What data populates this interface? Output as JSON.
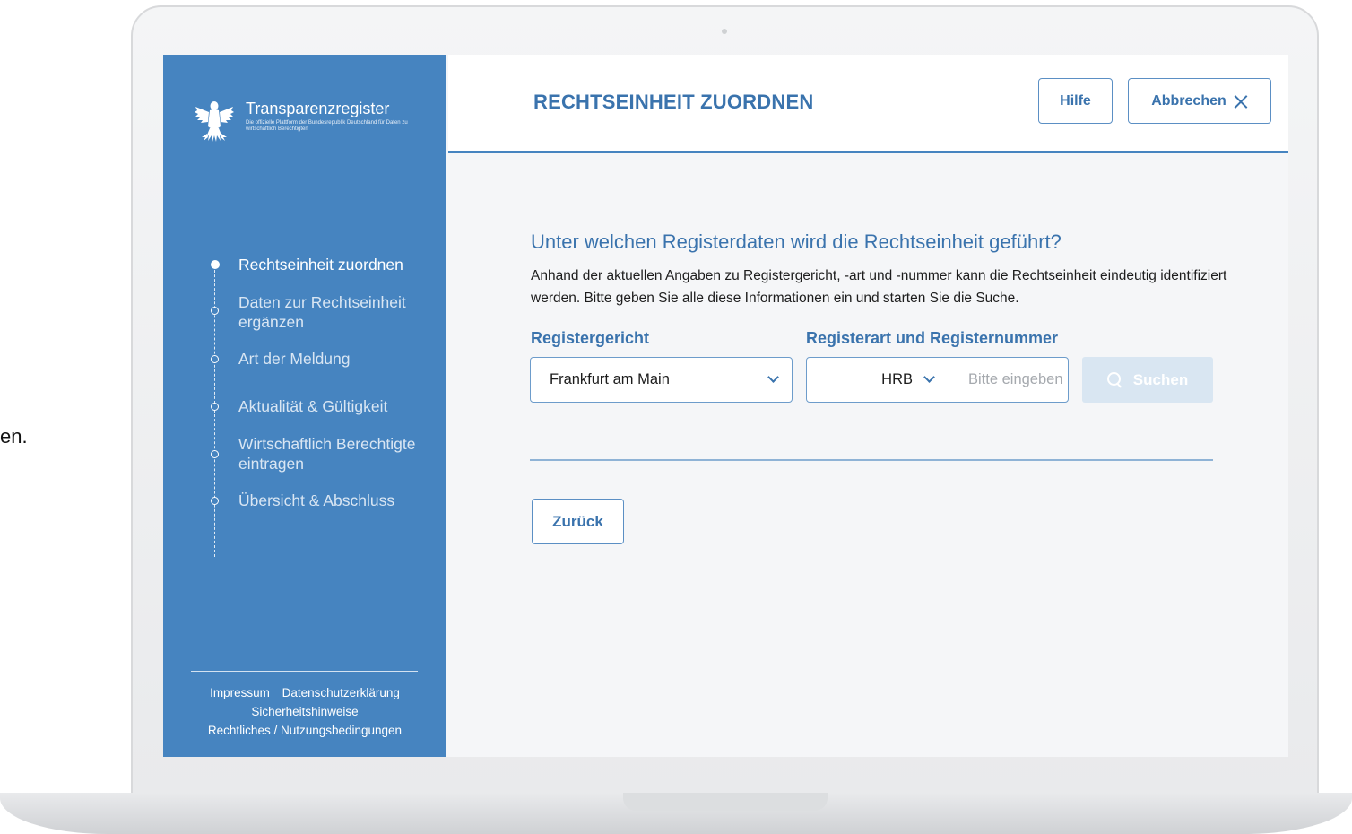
{
  "outside": {
    "fragment": "en."
  },
  "sidebar": {
    "brand_title": "Transparenzregister",
    "brand_subtitle": "Die offizielle Plattform der Bundesrepublik Deutschland für Daten zu wirtschaftlich Berechtigten",
    "logo_icon": "federal-eagle-icon",
    "steps": [
      {
        "label": "Rechtseinheit zuordnen",
        "active": true
      },
      {
        "label": "Daten zur Rechtseinheit ergänzen",
        "active": false
      },
      {
        "label": "Art der Meldung",
        "active": false
      },
      {
        "label": "Aktualität & Gültigkeit",
        "active": false
      },
      {
        "label": "Wirtschaftlich Berechtigte eintragen",
        "active": false
      },
      {
        "label": "Übersicht & Abschluss",
        "active": false
      }
    ],
    "footer": {
      "impressum": "Impressum",
      "datenschutz": "Datenschutzerklärung",
      "sicherheit": "Sicherheitshinweise",
      "rechtliches": "Rechtliches / Nutzungsbedingungen"
    }
  },
  "header": {
    "title": "RECHTSEINHEIT ZUORDNEN",
    "help_label": "Hilfe",
    "cancel_label": "Abbrechen"
  },
  "main": {
    "question": "Unter welchen Registerdaten wird die Rechtseinheit geführt?",
    "description": "Anhand der aktuellen Angaben zu Registergericht, -art und -nummer kann die Rechtseinheit eindeutig identifiziert werden. Bitte geben Sie alle diese Informationen ein und starten Sie die Suche.",
    "court_label": "Registergericht",
    "court_value": "Frankfurt am Main",
    "type_label": "Registerart und Registernummer",
    "type_value": "HRB",
    "number_placeholder": "Bitte eingeben",
    "search_label": "Suchen",
    "back_label": "Zurück"
  },
  "colors": {
    "sidebar": "#4684c0",
    "accent": "#3a73ad",
    "search_disabled": "#d9e6f2"
  }
}
